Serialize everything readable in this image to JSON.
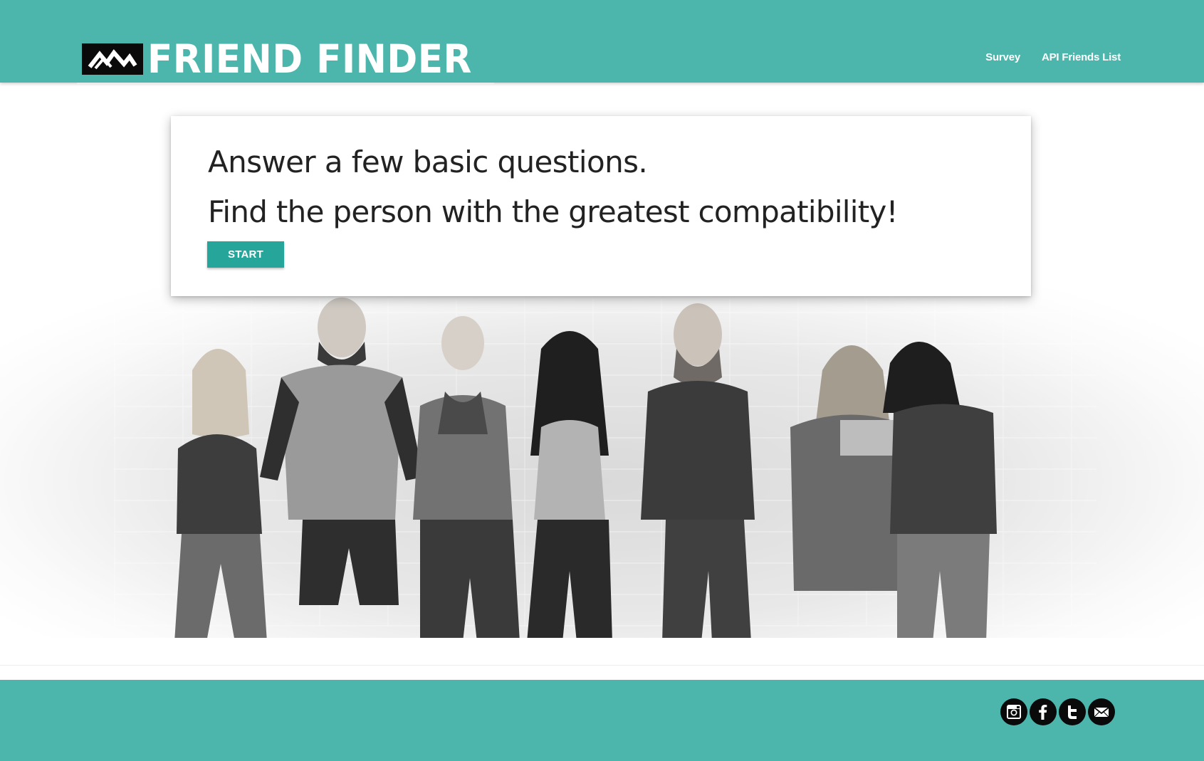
{
  "header": {
    "brand": "FRIEND FINDER",
    "logo_icon": "mountain-logo-icon",
    "nav": [
      "Survey",
      "API Friends List"
    ],
    "background": "#4db6ac"
  },
  "card": {
    "line1": "Answer a few basic questions.",
    "line2": "Find the person with the greatest compatibility!",
    "start_label": "START",
    "button_color": "#26a69a"
  },
  "hero": {
    "image": "grayscale group photo of eight friends"
  },
  "footer": {
    "background": "#4db6ac",
    "social_icons": [
      "instagram-icon",
      "facebook-icon",
      "twitter-icon",
      "email-icon"
    ]
  }
}
